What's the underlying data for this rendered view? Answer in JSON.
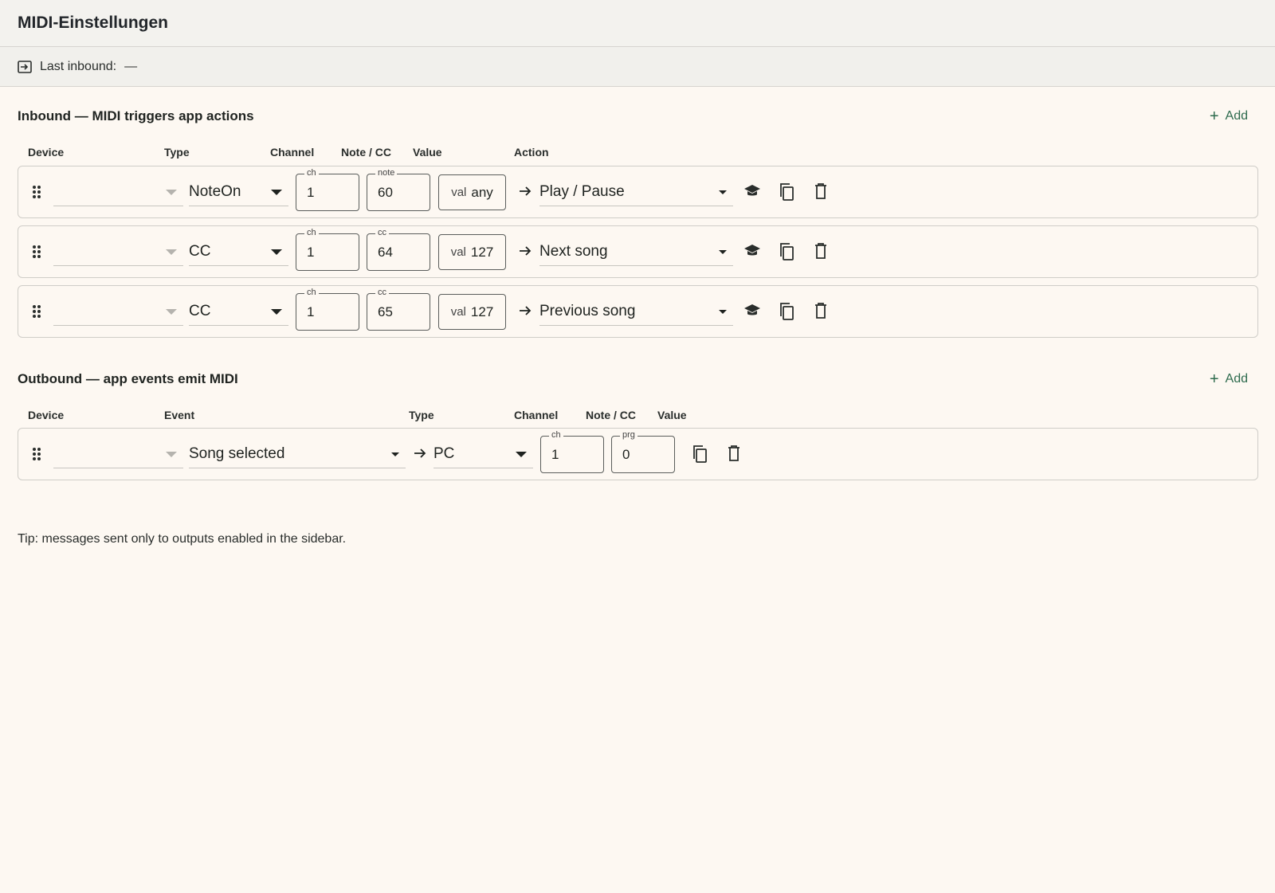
{
  "title": "MIDI-Einstellungen",
  "status": {
    "label": "Last inbound:",
    "value": "—"
  },
  "inbound": {
    "heading": "Inbound — MIDI triggers app actions",
    "add_label": "Add",
    "columns": {
      "device": "Device",
      "type": "Type",
      "channel": "Channel",
      "note_cc": "Note / CC",
      "value": "Value",
      "action": "Action"
    },
    "rows": [
      {
        "device": "",
        "type": "NoteOn",
        "ch_legend": "ch",
        "channel": "1",
        "num_legend": "note",
        "number": "60",
        "val_label": "val",
        "value": "any",
        "action": "Play / Pause"
      },
      {
        "device": "",
        "type": "CC",
        "ch_legend": "ch",
        "channel": "1",
        "num_legend": "cc",
        "number": "64",
        "val_label": "val",
        "value": "127",
        "action": "Next song"
      },
      {
        "device": "",
        "type": "CC",
        "ch_legend": "ch",
        "channel": "1",
        "num_legend": "cc",
        "number": "65",
        "val_label": "val",
        "value": "127",
        "action": "Previous song"
      }
    ]
  },
  "outbound": {
    "heading": "Outbound — app events emit MIDI",
    "add_label": "Add",
    "columns": {
      "device": "Device",
      "event": "Event",
      "type": "Type",
      "channel": "Channel",
      "note_cc": "Note / CC",
      "value": "Value"
    },
    "rows": [
      {
        "device": "",
        "event": "Song selected",
        "type": "PC",
        "ch_legend": "ch",
        "channel": "1",
        "num_legend": "prg",
        "number": "0"
      }
    ]
  },
  "tip": "Tip: messages sent only to outputs enabled in the sidebar.",
  "icons": {
    "status": "inbound-icon",
    "drag": "drag-handle-icon",
    "learn": "school-cap-icon",
    "copy": "copy-icon",
    "delete": "trash-icon",
    "arrow": "arrow-right-icon"
  },
  "colors": {
    "accent": "#2e6b4e",
    "background": "#fdf8f2",
    "header": "#f3f2ee"
  }
}
